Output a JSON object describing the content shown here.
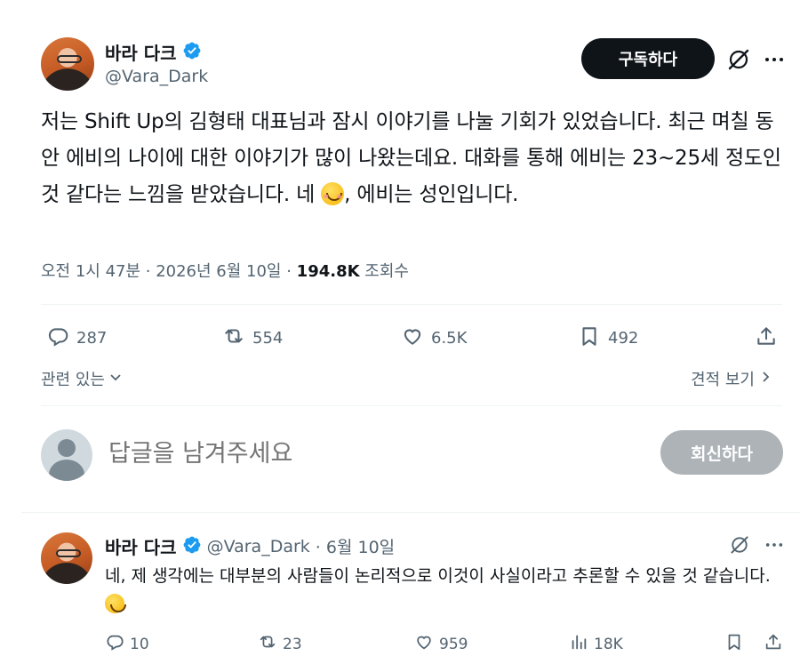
{
  "tweet": {
    "author_name": "바라 다크",
    "author_handle": "@Vara_Dark",
    "subscribe_label": "구독하다",
    "text_part1": "저는 Shift Up의 김형태 대표님과 잠시 이야기를 나눌 기회가 있었습니다. 최근 며칠 동안 에비의 나이에 대한 이야기가 많이 나왔는데요. 대화를 통해 에비는 23~25세 정도인 것 같다는 느낌을 받았습니다. 네 ",
    "text_part2": ", 에비는 성인입니다.",
    "timestamp": "오전 1시 47분 · 2026년 6월 10일 · ",
    "views_count": "194.8K",
    "views_label": " 조회수",
    "replies": "287",
    "retweets": "554",
    "likes": "6.5K",
    "bookmarks": "492",
    "related_label": "관련 있는",
    "quotes_label": "견적 보기"
  },
  "composer": {
    "placeholder": "답글을 남겨주세요",
    "reply_label": "회신하다"
  },
  "reply": {
    "author_name": "바라 다크",
    "author_handle": "@Vara_Dark",
    "date": "· 6월 10일",
    "text": "네, 제 생각에는 대부분의 사람들이 논리적으로 이것이 사실이라고 추론할 수 있을 것 같습니다.",
    "replies": "10",
    "retweets": "23",
    "likes": "959",
    "views": "18K"
  },
  "colors": {
    "verified": "#1d9bf0",
    "text_primary": "#0f1419",
    "text_secondary": "#536471",
    "divider": "#eff3f4"
  },
  "icons": [
    "verified-badge-icon",
    "grok-icon",
    "more-icon",
    "reply-icon",
    "retweet-icon",
    "like-icon",
    "bookmark-icon",
    "share-icon",
    "views-icon",
    "chevron-down-icon",
    "chevron-right-icon"
  ]
}
